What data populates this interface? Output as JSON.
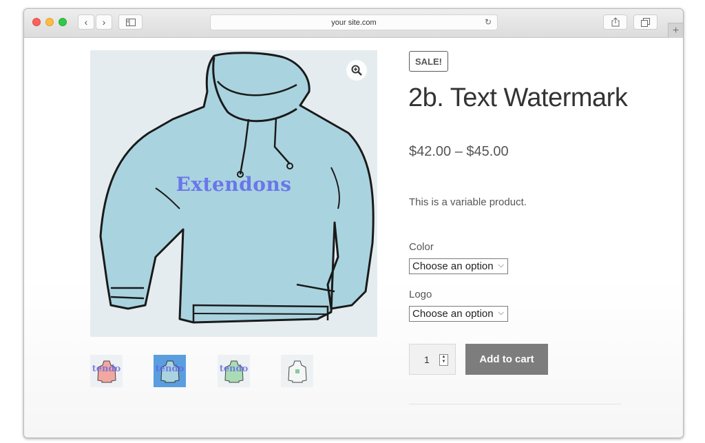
{
  "browser": {
    "url": "your site.com",
    "nav_back": "‹",
    "nav_forward": "›",
    "new_tab": "+"
  },
  "product": {
    "badge": "SALE!",
    "title": "2b. Text Watermark",
    "price": "$42.00 – $45.00",
    "description": "This is a variable product.",
    "watermark": "Extendons",
    "thumb_watermark": "tendo"
  },
  "options": {
    "color": {
      "label": "Color",
      "value": "Choose an option"
    },
    "logo": {
      "label": "Logo",
      "value": "Choose an option"
    }
  },
  "cart": {
    "quantity": "1",
    "button_label": "Add to cart"
  },
  "colors": {
    "hoodie_main": "#a9d3df",
    "thumb_pink": "#f2a7a0",
    "thumb_active": "#5a9ee0",
    "thumb_green": "#a9dcb5",
    "watermark": "#5a5feb",
    "cart_button": "#7d7d7d"
  }
}
